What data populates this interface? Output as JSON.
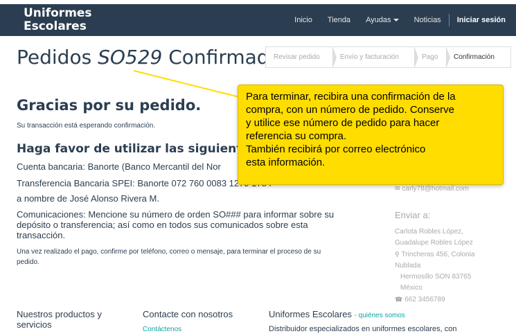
{
  "nav": {
    "brand_line1": "Uniformes",
    "brand_line2": "Escolares",
    "items": [
      "Inicio",
      "Tienda",
      "Ayudas",
      "Noticias"
    ],
    "login": "Iniciar sesión"
  },
  "header": {
    "title_prefix": "Pedidos",
    "order_id": "SO529",
    "title_suffix": "Confirmado"
  },
  "wizard": {
    "steps": [
      "Revisar pedido",
      "Envío y facturación",
      "Pago",
      "Confirmación"
    ],
    "active_step": "Confirmación"
  },
  "main": {
    "thanks": "Gracias por su pedido.",
    "pending": "Su transacción está esperando confirmación.",
    "instructions_title": "Haga favor de utilizar las siguientes re",
    "bank_account": "Cuenta bancaria: Banorte (Banco Mercantil del Nor",
    "spei": "Transferencia Bancaria SPEI: Banorte 072 760 0083 1279 1784",
    "holder": "a nombre de José Alonso Rivera M.",
    "comms": "Comunicaciones:  Mencione su número de orden SO###  para informar sobre su depósito o transferencia; así como en todos sus comunicados sobre esta transacción.",
    "after_payment": "Una vez realizado el pago, confirme por teléfono, correo o mensaje, para terminar el proceso de su pedido."
  },
  "sidebar": {
    "email": "carly78@hotmail.com",
    "ship_title": "Enviar a:",
    "ship_name": "Carlota Robles López,",
    "ship_name2": "Guadalupe Robles López",
    "ship_street": "Trincheras 456, Colonia Nublada",
    "ship_city": "Hermosillo SON 83765",
    "ship_country": "México",
    "phone": "662 3456789"
  },
  "footer": {
    "col1_title": "Nuestros productos y servicios",
    "col2_title": "Contacte con nosotros",
    "col2_link": "Contáctenos",
    "col3_title": "Uniformes Escolares",
    "col3_tag": "- quiénes somos",
    "col3_desc": "Distribuidor especializados en uniformes escolares, con"
  },
  "tooltip": {
    "text": "Para terminar, recibira una confirmación de la\ncompra, con un número de pedido. Conserve\ny utilice ese número de pedido para hacer\nreferencia su compra.\nTambién recibirá por correo electrónico\nesta información."
  },
  "colors": {
    "navbar": "#2b3e51",
    "tooltip": "#ffdd00",
    "accent": "#0ea5a0"
  }
}
